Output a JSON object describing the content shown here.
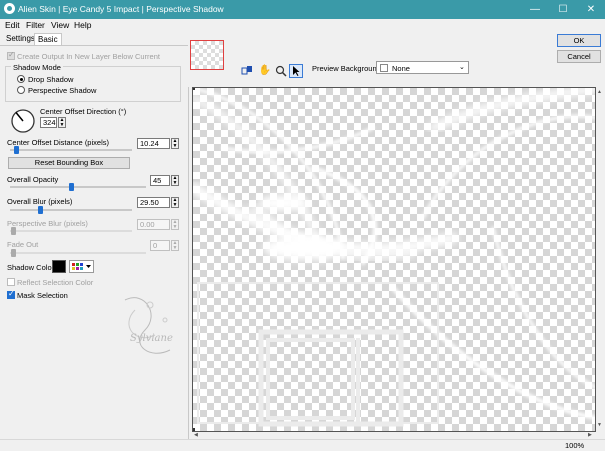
{
  "window": {
    "title": "Alien Skin | Eye Candy 5 Impact | Perspective Shadow",
    "minimize": "—",
    "maximize": "☐",
    "close": "✕"
  },
  "menu": [
    "Edit",
    "Filter",
    "View",
    "Help"
  ],
  "tabs": [
    "Settings",
    "Basic"
  ],
  "basic": {
    "create_output": "Create Output In New Layer Below Current",
    "shadow_mode_label": "Shadow Mode",
    "drop_shadow": "Drop Shadow",
    "perspective_shadow": "Perspective Shadow",
    "center_offset_direction_label": "Center Offset Direction (°)",
    "center_offset_direction_value": "324",
    "center_offset_distance_label": "Center Offset Distance (pixels)",
    "center_offset_distance_value": "10.24",
    "reset_bounding_box": "Reset Bounding Box",
    "overall_opacity_label": "Overall Opacity",
    "overall_opacity_value": "45",
    "overall_blur_label": "Overall Blur (pixels)",
    "overall_blur_value": "29.50",
    "perspective_blur_label": "Perspective Blur (pixels)",
    "perspective_blur_value": "0.00",
    "fade_out_label": "Fade Out",
    "fade_out_value": "0",
    "shadow_color_label": "Shadow Color",
    "shadow_color": "#000000",
    "reflect_selection_color": "Reflect Selection Color",
    "mask_selection": "Mask Selection"
  },
  "preview": {
    "background_label": "Preview Background:",
    "background_value": "None"
  },
  "buttons": {
    "ok": "OK",
    "cancel": "Cancel"
  },
  "watermark": "Sylviane",
  "status": {
    "zoom": "100%"
  },
  "colors": {
    "titlebar": "#3a9aa8",
    "accent": "#1f6fd1"
  }
}
